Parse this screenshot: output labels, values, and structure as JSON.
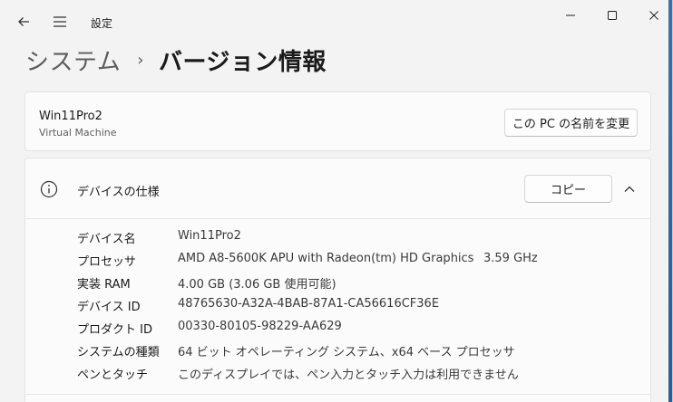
{
  "titlebar": {
    "app_title": "設定"
  },
  "breadcrumb": {
    "parent": "システム",
    "separator": "›",
    "current": "バージョン情報"
  },
  "pc_card": {
    "name": "Win11Pro2",
    "subtitle": "Virtual Machine",
    "rename_label": "この PC の名前を変更"
  },
  "spec_card": {
    "title": "デバイスの仕様",
    "copy_label": "コピー",
    "rows": [
      {
        "label": "デバイス名",
        "value": "Win11Pro2"
      },
      {
        "label": "プロセッサ",
        "value": "AMD A8-5600K APU with Radeon(tm) HD Graphics",
        "value2": "3.59 GHz"
      },
      {
        "label": "実装 RAM",
        "value": "4.00 GB (3.06 GB 使用可能)"
      },
      {
        "label": "デバイス ID",
        "value": "48765630-A32A-4BAB-87A1-CA56616CF36E"
      },
      {
        "label": "プロダクト ID",
        "value": "00330-80105-98229-AA629"
      },
      {
        "label": "システムの種類",
        "value": "64 ビット オペレーティング システム、x64 ベース プロセッサ"
      },
      {
        "label": "ペンとタッチ",
        "value": "このディスプレイでは、ペン入力とタッチ入力は利用できません"
      }
    ]
  },
  "icons": {
    "back": "back-arrow-icon",
    "menu": "hamburger-menu-icon",
    "info": "info-icon",
    "chevron": "chevron-up-icon"
  },
  "colors": {
    "window_bg": "#f3f3f3",
    "card_bg": "#fbfbfb",
    "accent_edge": "#2a5d98"
  }
}
